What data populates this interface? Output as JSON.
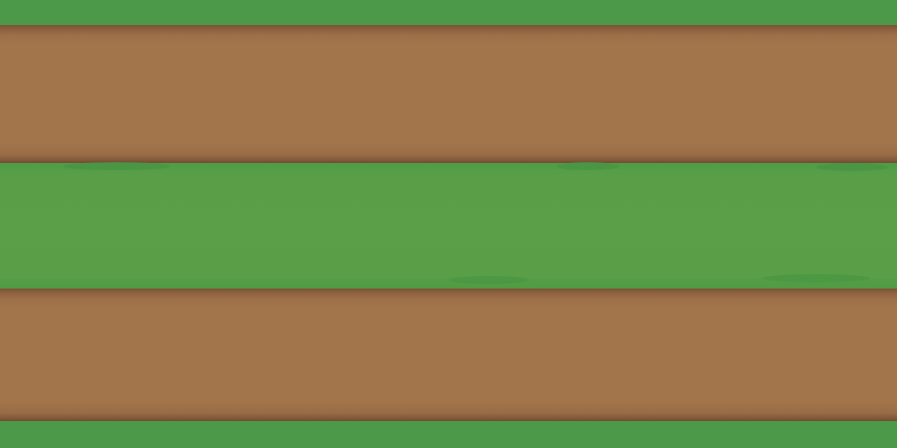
{
  "scene": {
    "type": "top-down tile strip",
    "lanes": [
      "grass",
      "dirt",
      "grass",
      "dirt",
      "grass"
    ],
    "colors": {
      "grass": "#4c9a49",
      "grass_light": "#5b9f49",
      "dirt": "#a2754b",
      "dirt_edge": "#7a5234"
    }
  }
}
